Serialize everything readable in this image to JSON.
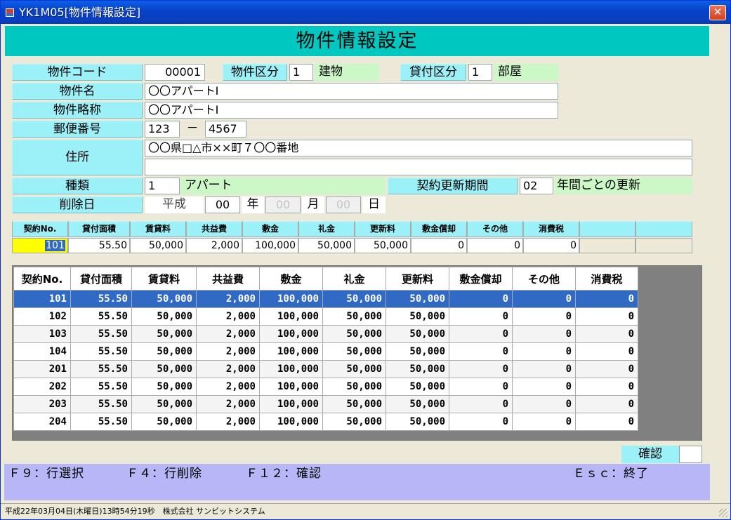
{
  "window": {
    "title": "YK1M05[物件情報設定]",
    "close_label": "✕"
  },
  "header": {
    "title": "物件情報設定"
  },
  "form": {
    "code_label": "物件コード",
    "code_value": "00001",
    "kubun_label": "物件区分",
    "kubun_value": "1",
    "kubun_name": "建物",
    "kashi_label": "貸付区分",
    "kashi_value": "1",
    "kashi_name": "部屋",
    "name_label": "物件名",
    "name_value": "〇〇アパートⅠ",
    "short_label": "物件略称",
    "short_value": "〇〇アパートⅠ",
    "zip_label": "郵便番号",
    "zip1": "123",
    "zip_sep": "－",
    "zip2": "4567",
    "addr_label": "住所",
    "addr1": "〇〇県□△市××町７〇〇番地",
    "addr2": "",
    "type_label": "種類",
    "type_value": "1",
    "type_name": "アパート",
    "renew_label": "契約更新期間",
    "renew_value": "02",
    "renew_suffix": "年間ごとの更新",
    "del_label": "削除日",
    "era": "平成",
    "year": "00",
    "year_unit": "年",
    "month": "00",
    "month_unit": "月",
    "day": "00",
    "day_unit": "日"
  },
  "edit": {
    "headers": [
      "契約No.",
      "貸付面積",
      "賃貸料",
      "共益費",
      "敷金",
      "礼金",
      "更新料",
      "敷金償却",
      "その他",
      "消費税",
      "",
      ""
    ],
    "values": [
      "101",
      "55.50",
      "50,000",
      "2,000",
      "100,000",
      "50,000",
      "50,000",
      "0",
      "0",
      "0",
      "",
      ""
    ]
  },
  "grid": {
    "headers": [
      "契約No.",
      "貸付面積",
      "賃貸料",
      "共益費",
      "敷金",
      "礼金",
      "更新料",
      "敷金償却",
      "その他",
      "消費税"
    ],
    "rows": [
      [
        "101",
        "55.50",
        "50,000",
        "2,000",
        "100,000",
        "50,000",
        "50,000",
        "0",
        "0",
        "0"
      ],
      [
        "102",
        "55.50",
        "50,000",
        "2,000",
        "100,000",
        "50,000",
        "50,000",
        "0",
        "0",
        "0"
      ],
      [
        "103",
        "55.50",
        "50,000",
        "2,000",
        "100,000",
        "50,000",
        "50,000",
        "0",
        "0",
        "0"
      ],
      [
        "104",
        "55.50",
        "50,000",
        "2,000",
        "100,000",
        "50,000",
        "50,000",
        "0",
        "0",
        "0"
      ],
      [
        "201",
        "55.50",
        "50,000",
        "2,000",
        "100,000",
        "50,000",
        "50,000",
        "0",
        "0",
        "0"
      ],
      [
        "202",
        "55.50",
        "50,000",
        "2,000",
        "100,000",
        "50,000",
        "50,000",
        "0",
        "0",
        "0"
      ],
      [
        "203",
        "55.50",
        "50,000",
        "2,000",
        "100,000",
        "50,000",
        "50,000",
        "0",
        "0",
        "0"
      ],
      [
        "204",
        "55.50",
        "50,000",
        "2,000",
        "100,000",
        "50,000",
        "50,000",
        "0",
        "0",
        "0"
      ]
    ]
  },
  "confirm": {
    "label": "確認",
    "value": ""
  },
  "fkeys": {
    "f9": "Ｆ９：行選択",
    "f4": "Ｆ４：行削除",
    "f12": "Ｆ１２：確認",
    "esc": "Ｅｓｃ：終了"
  },
  "status": {
    "text": "平成22年03月04日(木曜日)13時54分19秒　株式会社 サンビットシステム"
  },
  "colors": {
    "selected_row": "#316ac5",
    "header_band": "#00c8c0",
    "label_bg": "#9cf0f8",
    "fkey_bar": "#b7b7f7",
    "edit_highlight": "#ffff00"
  }
}
